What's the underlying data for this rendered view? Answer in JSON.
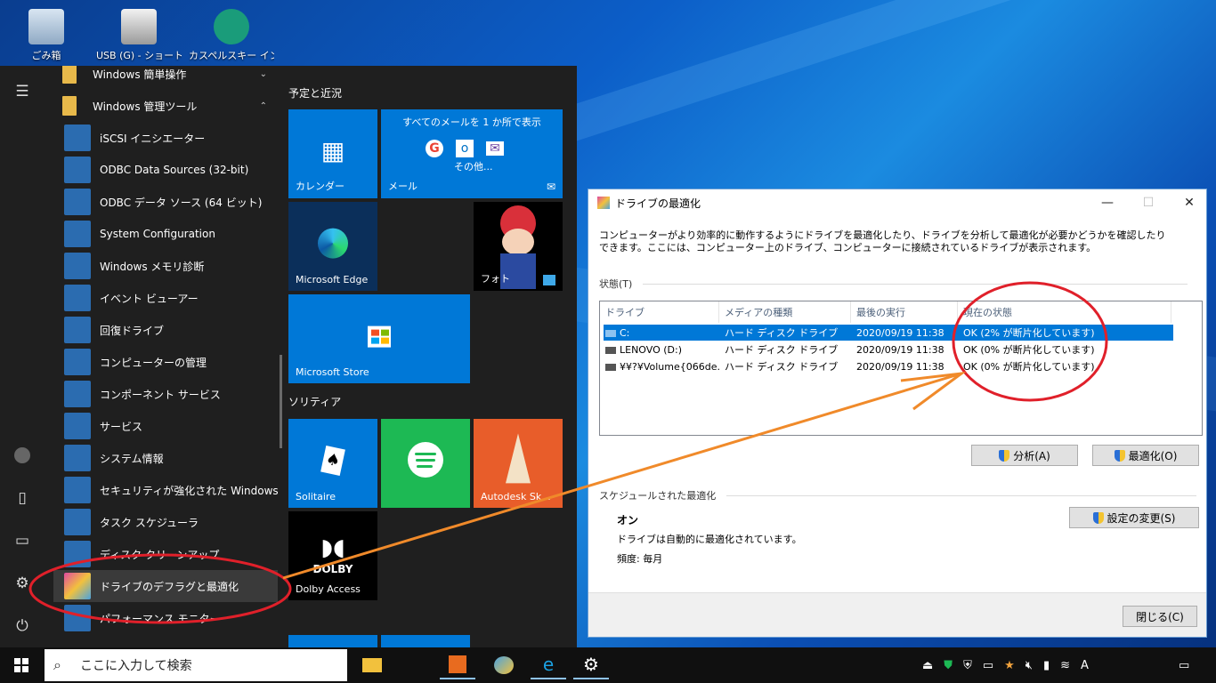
{
  "desktop": {
    "icons": [
      {
        "label": "ごみ箱",
        "icon": "recycle-bin-icon"
      },
      {
        "label": "USB (G) - ショートカット",
        "icon": "usb-drive-icon"
      },
      {
        "label": "カスペルスキー インター",
        "icon": "kaspersky-icon"
      }
    ]
  },
  "start_menu": {
    "apps": [
      {
        "label": "Windows 簡単操作",
        "chevron": "⌄"
      },
      {
        "label": "Windows 管理ツール",
        "chevron": "⌃"
      },
      {
        "label": "iSCSI イニシエーター"
      },
      {
        "label": "ODBC Data Sources (32-bit)"
      },
      {
        "label": "ODBC データ ソース (64 ビット)"
      },
      {
        "label": "System Configuration"
      },
      {
        "label": "Windows メモリ診断"
      },
      {
        "label": "イベント ビューアー"
      },
      {
        "label": "回復ドライブ"
      },
      {
        "label": "コンピューターの管理"
      },
      {
        "label": "コンポーネント サービス"
      },
      {
        "label": "サービス"
      },
      {
        "label": "システム情報"
      },
      {
        "label": "セキュリティが強化された Windows De..."
      },
      {
        "label": "タスク スケジューラ"
      },
      {
        "label": "ディスク クリーンアップ"
      },
      {
        "label": "ドライブのデフラグと最適化"
      },
      {
        "label": "パフォーマンス モニター"
      }
    ],
    "groups": {
      "plans": "予定と近況",
      "solitaire": "ソリティア"
    },
    "tiles": {
      "calendar": "カレンダー",
      "mail_header": "すべてのメールを 1 か所で表示",
      "mail_other": "その他...",
      "mail": "メール",
      "edge": "Microsoft Edge",
      "photos": "フォト",
      "store": "Microsoft Store",
      "solitaire": "Solitaire",
      "autodesk": "Autodesk Sk...",
      "dolby_logo": "DOLBY",
      "dolby": "Dolby Access"
    }
  },
  "taskbar": {
    "search_placeholder": "ここに入力して検索",
    "ime": "A"
  },
  "dialog": {
    "title": "ドライブの最適化",
    "description": "コンピューターがより効率的に動作するようにドライブを最適化したり、ドライブを分析して最適化が必要かどうかを確認したりできます。ここには、コンピューター上のドライブ、コンピューターに接続されているドライブが表示されます。",
    "status_label": "状態(T)",
    "columns": [
      "ドライブ",
      "メディアの種類",
      "最後の実行",
      "現在の状態"
    ],
    "rows": [
      {
        "drive": "C:",
        "media": "ハード ディスク ドライブ",
        "last_run": "2020/09/19 11:38",
        "status": "OK (2% が断片化しています)"
      },
      {
        "drive": "LENOVO (D:)",
        "media": "ハード ディスク ドライブ",
        "last_run": "2020/09/19 11:38",
        "status": "OK (0% が断片化しています)"
      },
      {
        "drive": "¥¥?¥Volume{066de...",
        "media": "ハード ディスク ドライブ",
        "last_run": "2020/09/19 11:38",
        "status": "OK (0% が断片化しています)"
      }
    ],
    "analyze_button": "分析(A)",
    "optimize_button": "最適化(O)",
    "scheduled_label": "スケジュールされた最適化",
    "schedule_state": "オン",
    "schedule_desc": "ドライブは自動的に最適化されています。",
    "frequency": "頻度: 毎月",
    "change_settings_button": "設定の変更(S)",
    "close_button": "閉じる(C)"
  },
  "colors": {
    "tile_blue": "#0078d7",
    "spotify_green": "#1db954",
    "autodesk_orange": "#e85d2a",
    "annotation_red": "#e0202a",
    "annotation_orange": "#f08a2a"
  }
}
